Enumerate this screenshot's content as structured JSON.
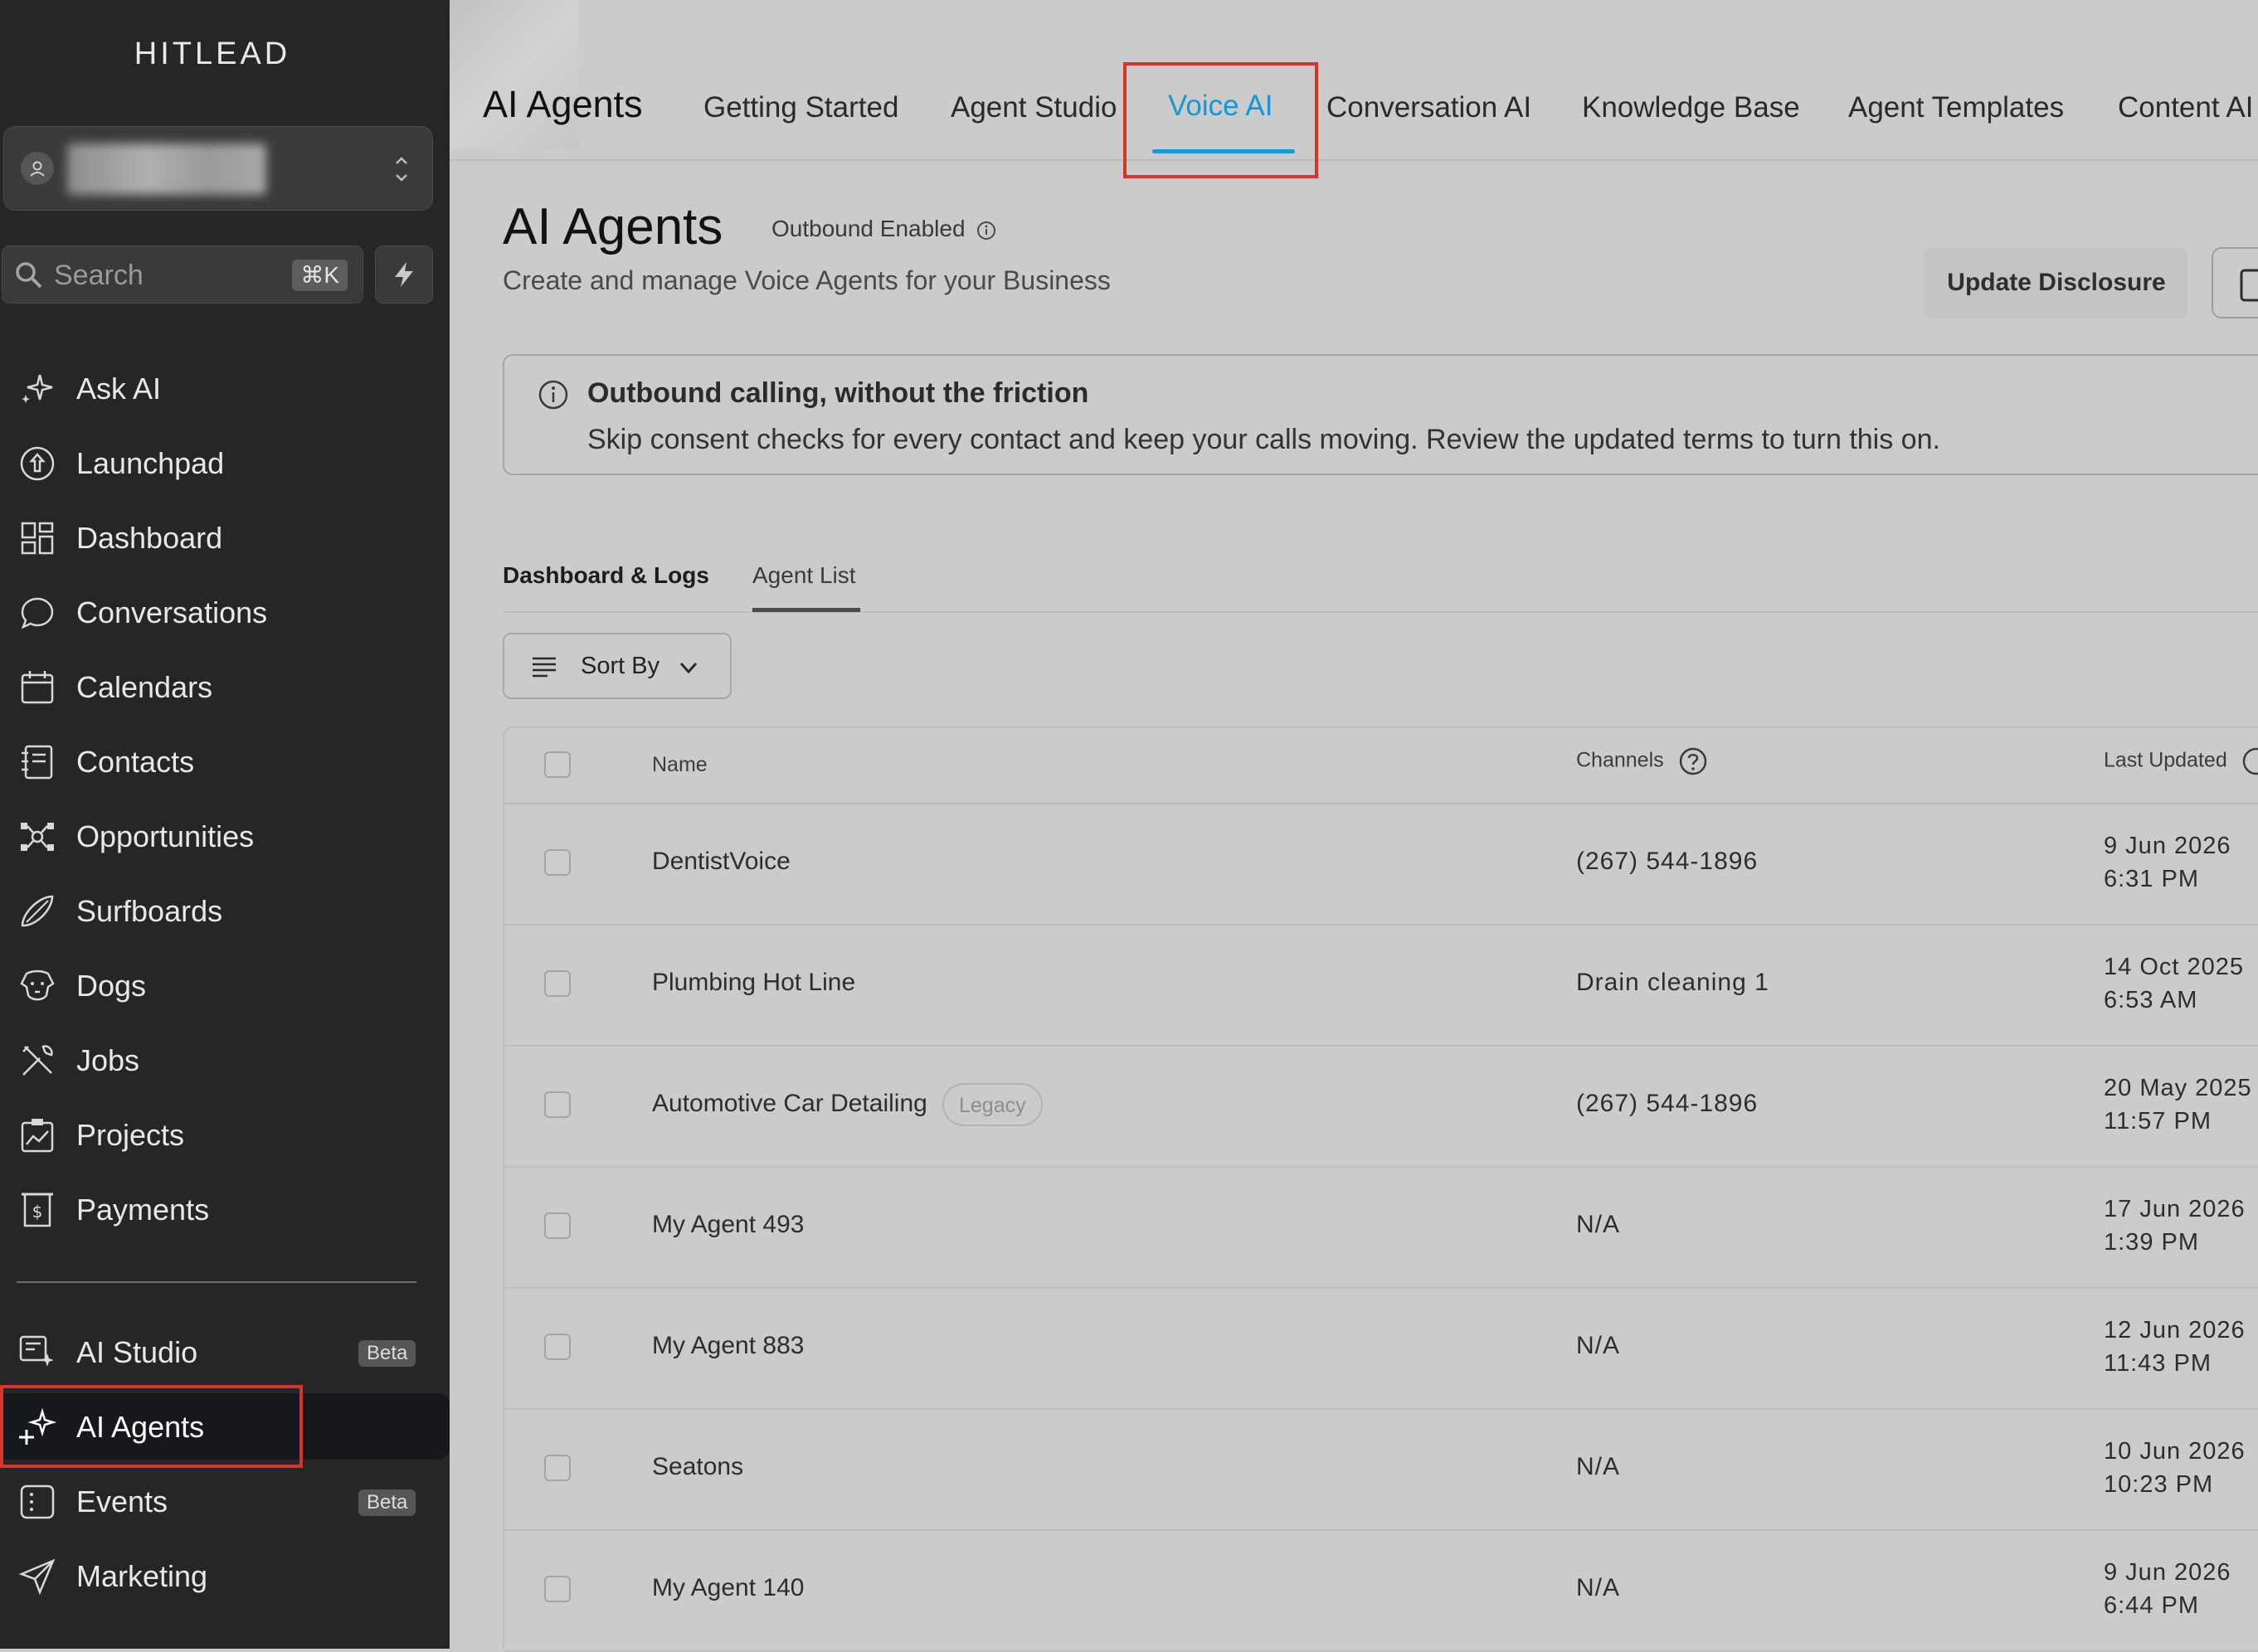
{
  "sidebar": {
    "brand": "HITLEAD",
    "search": {
      "placeholder": "Search",
      "shortcut": "⌘K"
    },
    "items": [
      {
        "label": "Ask AI",
        "icon": "sparkle-icon"
      },
      {
        "label": "Launchpad",
        "icon": "rocket-icon"
      },
      {
        "label": "Dashboard",
        "icon": "grid-icon"
      },
      {
        "label": "Conversations",
        "icon": "chat-bubble-icon"
      },
      {
        "label": "Calendars",
        "icon": "calendar-icon"
      },
      {
        "label": "Contacts",
        "icon": "contact-book-icon"
      },
      {
        "label": "Opportunities",
        "icon": "network-icon"
      },
      {
        "label": "Surfboards",
        "icon": "surfboard-icon"
      },
      {
        "label": "Dogs",
        "icon": "dog-icon"
      },
      {
        "label": "Jobs",
        "icon": "tools-icon"
      },
      {
        "label": "Projects",
        "icon": "chart-board-icon"
      },
      {
        "label": "Payments",
        "icon": "receipt-icon"
      }
    ],
    "bottom_items": [
      {
        "label": "AI Studio",
        "icon": "ai-studio-icon",
        "badge": "Beta"
      },
      {
        "label": "AI Agents",
        "icon": "sparkles-icon",
        "active": true
      },
      {
        "label": "Events",
        "icon": "events-icon",
        "badge": "Beta"
      },
      {
        "label": "Marketing",
        "icon": "send-icon"
      }
    ]
  },
  "topbar": {
    "title": "AI Agents",
    "tabs": [
      {
        "label": "Getting Started"
      },
      {
        "label": "Agent Studio"
      },
      {
        "label": "Voice AI",
        "active": true
      },
      {
        "label": "Conversation AI"
      },
      {
        "label": "Knowledge Base"
      },
      {
        "label": "Agent Templates"
      },
      {
        "label": "Content AI"
      }
    ]
  },
  "header": {
    "title": "AI Agents",
    "status": "Outbound Enabled",
    "subtitle": "Create and manage Voice Agents for your Business",
    "update_button": "Update Disclosure"
  },
  "banner": {
    "title": "Outbound calling, without the friction",
    "text": "Skip consent checks for every contact and keep your calls moving. Review the updated terms to turn this on."
  },
  "subtabs": [
    {
      "label": "Dashboard & Logs"
    },
    {
      "label": "Agent List",
      "active": true
    }
  ],
  "sort": {
    "label": "Sort By"
  },
  "table": {
    "columns": {
      "name": "Name",
      "channels": "Channels",
      "last_updated": "Last Updated"
    },
    "rows": [
      {
        "name": "DentistVoice",
        "channel": "(267) 544-1896",
        "date": "9 Jun 2026",
        "time": "6:31 PM"
      },
      {
        "name": "Plumbing Hot Line",
        "channel": "Drain cleaning 1",
        "date": "14 Oct 2025",
        "time": "6:53 AM"
      },
      {
        "name": "Automotive Car Detailing",
        "badge": "Legacy",
        "channel": "(267) 544-1896",
        "date": "20 May 2025",
        "time": "11:57 PM"
      },
      {
        "name": "My Agent 493",
        "channel": "N/A",
        "date": "17 Jun 2026",
        "time": "1:39 PM"
      },
      {
        "name": "My Agent 883",
        "channel": "N/A",
        "date": "12 Jun 2026",
        "time": "11:43 PM"
      },
      {
        "name": "Seatons",
        "channel": "N/A",
        "date": "10 Jun 2026",
        "time": "10:23 PM"
      },
      {
        "name": "My Agent 140",
        "channel": "N/A",
        "date": "9 Jun 2026",
        "time": "6:44 PM"
      }
    ]
  },
  "colors": {
    "accent": "#1597d6",
    "highlight": "#d7332a",
    "sidebar_bg": "#262626",
    "page_bg": "#cbcbcb"
  }
}
